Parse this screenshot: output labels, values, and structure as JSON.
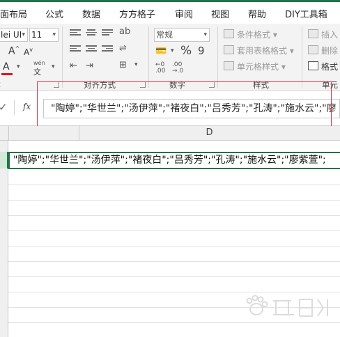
{
  "tabs": [
    "面布局",
    "公式",
    "数据",
    "方方格子",
    "审阅",
    "视图",
    "帮助",
    "DIY工具箱"
  ],
  "font": {
    "name": "lei UI",
    "size": "11",
    "grow": "A",
    "shrink": "A",
    "color_a": "A",
    "wen": "wén",
    "ab": "ab",
    "accent_color": "#e81123"
  },
  "number": {
    "format": "常规",
    "percent": "%",
    "comma": "9"
  },
  "styles": {
    "conditional": "条件格式",
    "table": "套用表格格式",
    "cell": "单元格样式"
  },
  "cells_group": {
    "insert": "插入",
    "delete": "删除",
    "format": "格式"
  },
  "groups": {
    "alignment": "对齐方式",
    "number": "数字",
    "styles": "样式",
    "cells": "单元"
  },
  "formula_bar": {
    "fx": "fx",
    "check": "✓",
    "value": "\"陶婷\";\"华世兰\";\"汤伊萍\";\"褚夜白\";\"吕秀芳\";\"孔涛\";\"施水云\";\"廖"
  },
  "grid": {
    "column": "D",
    "active_cell_value": "\"陶婷\";\"华世兰\";\"汤伊萍\";\"褚夜白\";\"吕秀芳\";\"孔涛\";\"施水云\";\"廖紫萱\";"
  },
  "colors": {
    "excel_green": "#217346",
    "highlight_red": "#e0353f"
  }
}
